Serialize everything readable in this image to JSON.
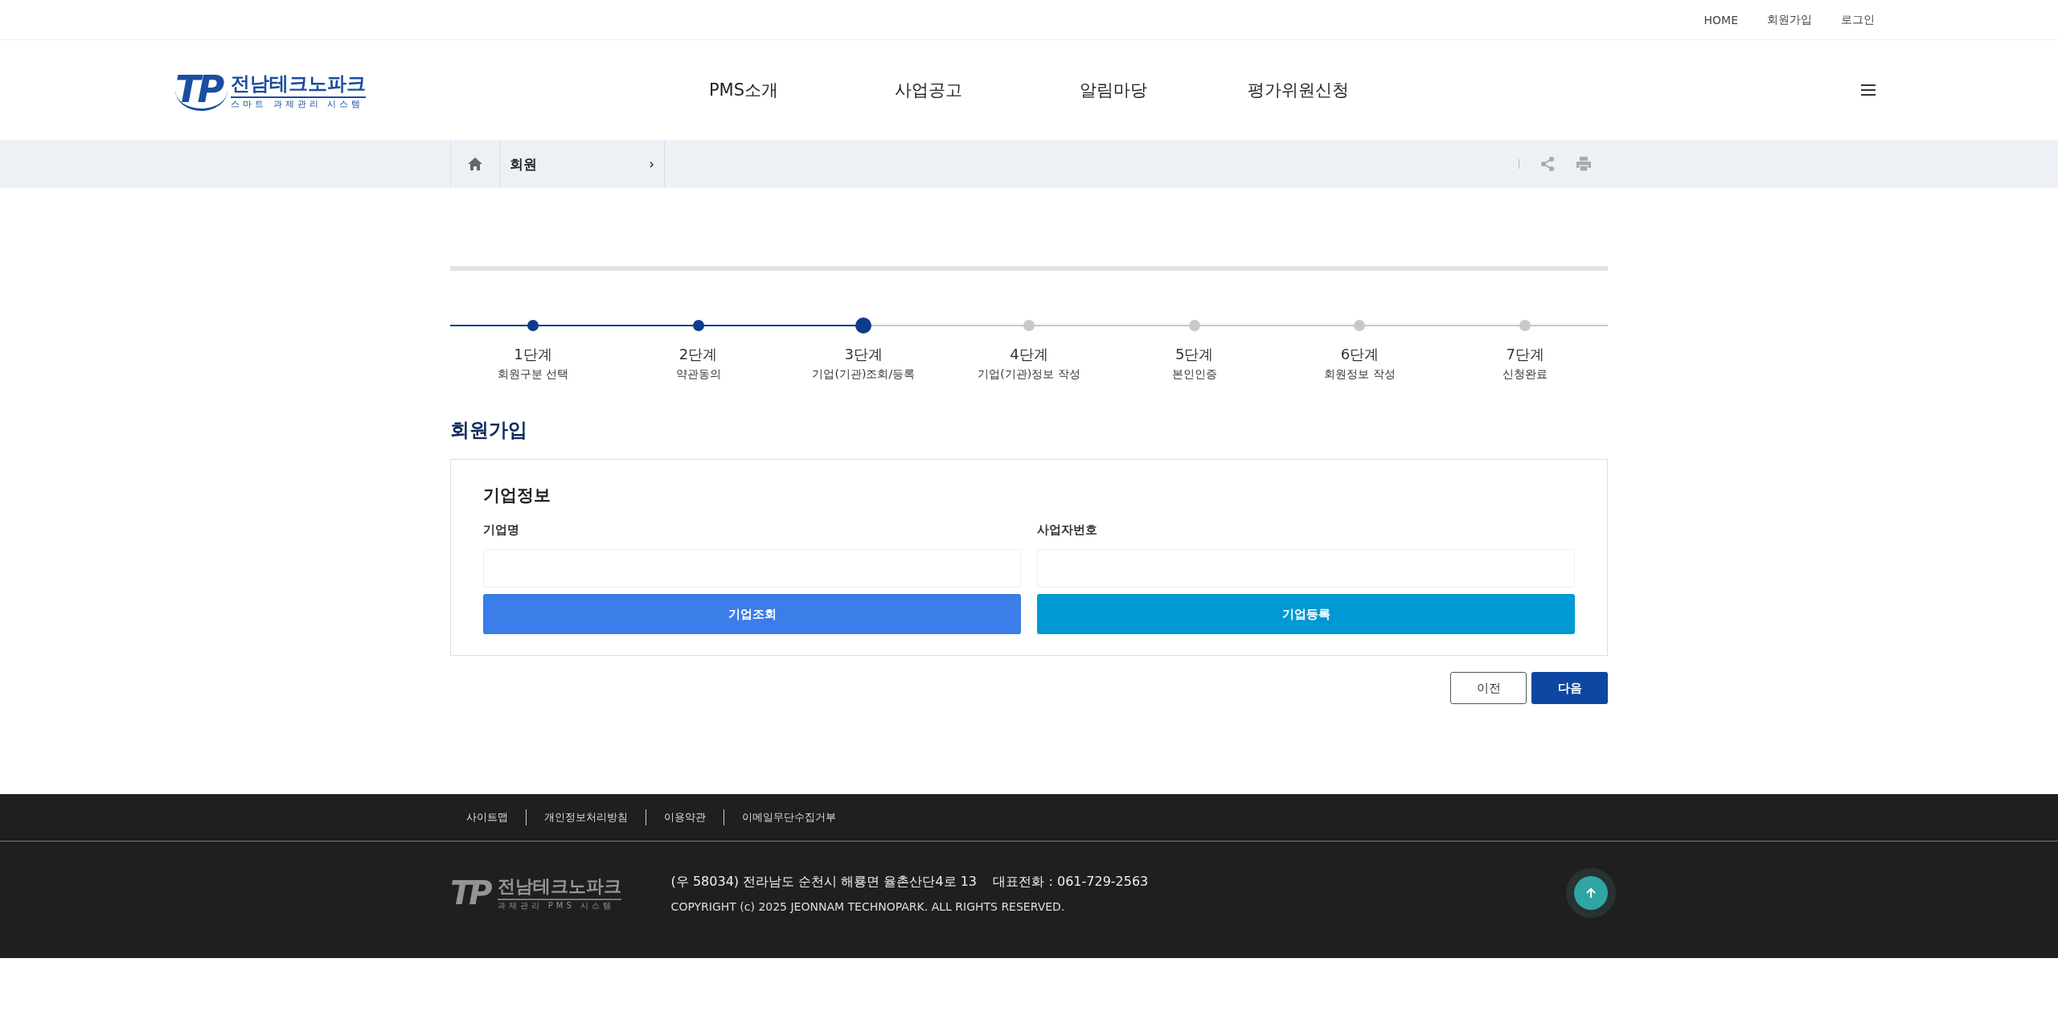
{
  "top_links": [
    "HOME",
    "회원가입",
    "로그인"
  ],
  "logo": {
    "mark": "TP",
    "name": "전남테크노파크",
    "subtitle": "스마트 과제관리 시스템"
  },
  "nav": [
    "PMS소개",
    "사업공고",
    "알림마당",
    "평가위원신청"
  ],
  "breadcrumb": {
    "current": "회원",
    "caret": "›"
  },
  "steps": [
    {
      "title": "1단계",
      "label": "회원구분 선택",
      "done": true,
      "selected": false
    },
    {
      "title": "2단계",
      "label": "약관동의",
      "done": true,
      "selected": false
    },
    {
      "title": "3단계",
      "label": "기업(기관)조회/등록",
      "done": false,
      "selected": true
    },
    {
      "title": "4단계",
      "label": "기업(기관)정보 작성",
      "done": false,
      "selected": false
    },
    {
      "title": "5단계",
      "label": "본인인증",
      "done": false,
      "selected": false
    },
    {
      "title": "6단계",
      "label": "회원정보 작성",
      "done": false,
      "selected": false
    },
    {
      "title": "7단계",
      "label": "신청완료",
      "done": false,
      "selected": false
    }
  ],
  "page_title": "회원가입",
  "form": {
    "section": "기업정보",
    "fields": [
      {
        "label": "기업명",
        "button": "기업조회",
        "kind": "search"
      },
      {
        "label": "사업자번호",
        "button": "기업등록",
        "kind": "register"
      }
    ]
  },
  "actions": [
    {
      "label": "이전",
      "kind": "secondary"
    },
    {
      "label": "다음",
      "kind": "primary"
    }
  ],
  "footer": {
    "links": [
      "사이트맵",
      "개인정보처리방침",
      "이용약관",
      "이메일무단수집거부"
    ],
    "logo": {
      "mark": "TP",
      "name": "전남테크노파크",
      "subtitle": "과제관리 PMS 시스템"
    },
    "address": "(우 58034) 전라남도 순천시 해룡면 율촌산단4로 13    대표전화 : 061-729-2563",
    "copyright": "COPYRIGHT (c) 2025 JEONNAM TECHNOPARK. ALL RIGHTS RESERVED."
  }
}
